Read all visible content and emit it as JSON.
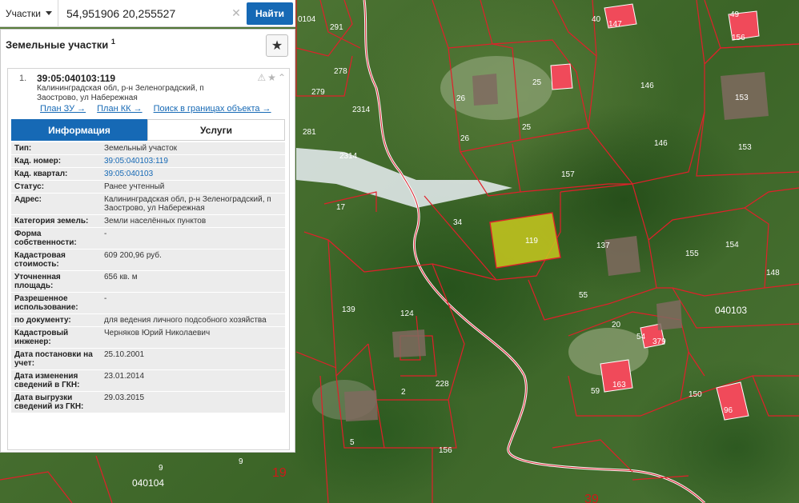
{
  "search": {
    "type_label": "Участки",
    "value": "54,951906 20,255527",
    "clear_icon": "close-icon",
    "button_label": "Найти"
  },
  "panel": {
    "title": "Земельные участки",
    "title_sup": "1",
    "favorite_icon": "star-icon"
  },
  "result": {
    "index": "1.",
    "cadastral_number": "39:05:040103:119",
    "address": "Калининградская обл, р-н Зеленоградский, п Заострово, ул Набережная",
    "icons": [
      "warning-icon",
      "star-icon",
      "chevron-up-icon"
    ],
    "links": [
      "План ЗУ →",
      "План КК →",
      "Поиск в границах объекта →"
    ]
  },
  "tabs": [
    {
      "label": "Информация",
      "active": true
    },
    {
      "label": "Услуги",
      "active": false
    }
  ],
  "attributes": [
    {
      "key": "Тип:",
      "value": "Земельный участок"
    },
    {
      "key": "Кад. номер:",
      "value": "39:05:040103:119",
      "link": true
    },
    {
      "key": "Кад. квартал:",
      "value": "39:05:040103",
      "link": true
    },
    {
      "key": "Статус:",
      "value": "Ранее учтенный"
    },
    {
      "key": "Адрес:",
      "value": "Калининградская обл, р-н Зеленоградский, п Заострово, ул Набережная"
    },
    {
      "key": "Категория земель:",
      "value": "Земли населённых пунктов"
    },
    {
      "key": "Форма собственности:",
      "value": "-"
    },
    {
      "key": "Кадастровая стоимость:",
      "value": "609 200,96 руб."
    },
    {
      "key": "Уточненная площадь:",
      "value": "656 кв. м"
    },
    {
      "key": "Разрешенное использование:",
      "value": "-"
    },
    {
      "key": "по документу:",
      "value": "для ведения личного подсобного хозяйства"
    },
    {
      "key": "Кадастровый инженер:",
      "value": "Черняков Юрий Николаевич"
    },
    {
      "key": "Дата постановки на учет:",
      "value": "25.10.2001"
    },
    {
      "key": "Дата изменения сведений в ГКН:",
      "value": "23.01.2014"
    },
    {
      "key": "Дата выгрузки сведений из ГКН:",
      "value": "29.03.2015"
    }
  ],
  "map": {
    "selected_parcel_label": "119",
    "quarter_labels": [
      "040104",
      "040103",
      "040104"
    ],
    "parcel_labels": [
      "0104",
      "291",
      "278",
      "279",
      "2314",
      "281",
      "2314",
      "17",
      "40",
      "147",
      "49",
      "156",
      "26",
      "25",
      "26",
      "25",
      "146",
      "146",
      "153",
      "153",
      "157",
      "34",
      "137",
      "155",
      "154",
      "148",
      "55",
      "139",
      "124",
      "20",
      "54",
      "379",
      "163",
      "2",
      "228",
      "59",
      "150",
      "96",
      "5",
      "156",
      "9",
      "9",
      "19",
      "39"
    ],
    "colors": {
      "boundary": "#e0202a",
      "selected_fill": "#c8c81e",
      "building": "#f04a5a"
    }
  }
}
